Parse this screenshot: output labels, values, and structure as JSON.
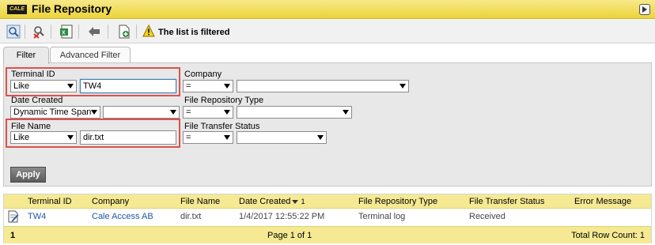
{
  "app": {
    "logo_text": "CALE",
    "title": "File Repository"
  },
  "toolbar": {
    "filtered_message": "The list is filtered",
    "buttons": [
      "search-icon",
      "clear-filter-icon",
      "export-excel-icon",
      "move-icon",
      "add-file-icon"
    ]
  },
  "tabs": [
    {
      "label": "Filter",
      "active": true
    },
    {
      "label": "Advanced Filter",
      "active": false
    }
  ],
  "filter": {
    "terminal_id": {
      "label": "Terminal ID",
      "operator": "Like",
      "value": "TW4"
    },
    "company": {
      "label": "Company",
      "operator": "=",
      "value": ""
    },
    "date_created": {
      "label": "Date Created",
      "operator": "Dynamic Time Span",
      "value": ""
    },
    "file_repository_type": {
      "label": "File Repository Type",
      "operator": "=",
      "value": ""
    },
    "file_name": {
      "label": "File Name",
      "operator": "Like",
      "value": "dir.txt"
    },
    "file_transfer_status": {
      "label": "File Transfer Status",
      "operator": "=",
      "value": ""
    },
    "apply_label": "Apply"
  },
  "table": {
    "columns": [
      "Terminal ID",
      "Company",
      "File Name",
      "Date Created",
      "File Repository Type",
      "File Transfer Status",
      "Error Message"
    ],
    "sort_index": "1",
    "rows": [
      {
        "terminal_id": "TW4",
        "company": "Cale Access AB",
        "file_name": "dir.txt",
        "date_created": "1/4/2017 12:55:22 PM",
        "type": "Terminal log",
        "status": "Received",
        "error": ""
      }
    ],
    "footer": {
      "page_number": "1",
      "page_info": "Page 1 of 1",
      "total": "Total Row Count: 1"
    }
  },
  "colors": {
    "header_yellow": "#f5ea93",
    "title_yellow": "#ecd43a",
    "link_blue": "#1f56a8",
    "highlight_red": "#d9534f"
  }
}
